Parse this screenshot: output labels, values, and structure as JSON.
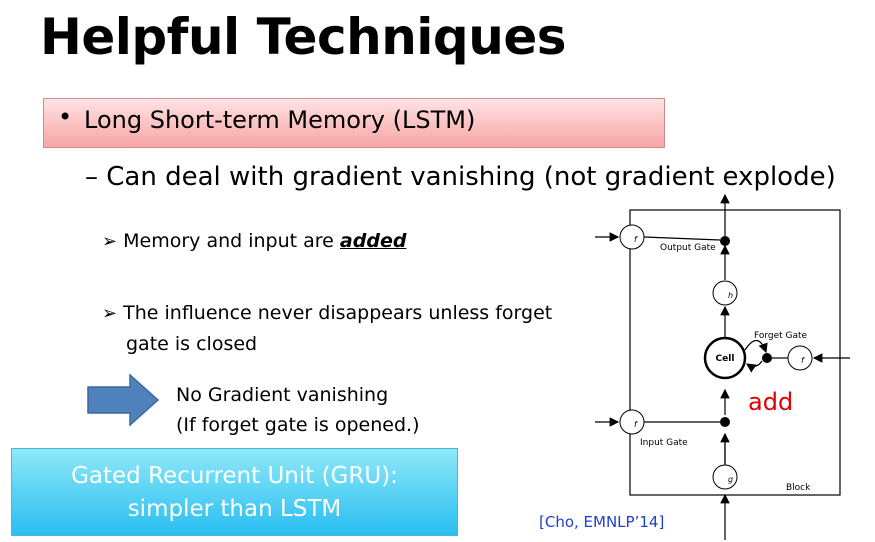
{
  "slide": {
    "title": "Helpful Techniques",
    "bullet_marker": "•",
    "bullet": "Long Short-term Memory (LSTM)",
    "sub_dash": "–",
    "sub_bullet": "Can deal with gradient vanishing (not gradient explode)",
    "point_marker": "➢",
    "point1_prefix": "Memory and input are ",
    "point1_emphasis": "added",
    "point2_line1": "The influence never disappears unless forget",
    "point2_line2": "gate is closed",
    "note_line1": "No Gradient vanishing",
    "note_line2": "(If forget gate is opened.)",
    "gru_line1": "Gated Recurrent Unit (GRU):",
    "gru_line2": "simpler than LSTM",
    "reference": "[Cho, EMNLP’14]"
  },
  "diagram": {
    "output_gate": "Output Gate",
    "forget_gate": "Forget Gate",
    "input_gate": "Input Gate",
    "cell": "Cell",
    "block": "Block",
    "add_label": "add",
    "f_label": "f",
    "h_label": "h",
    "g_label": "g",
    "add_color": "#e00000",
    "arrow_color": "#4f81bd"
  }
}
